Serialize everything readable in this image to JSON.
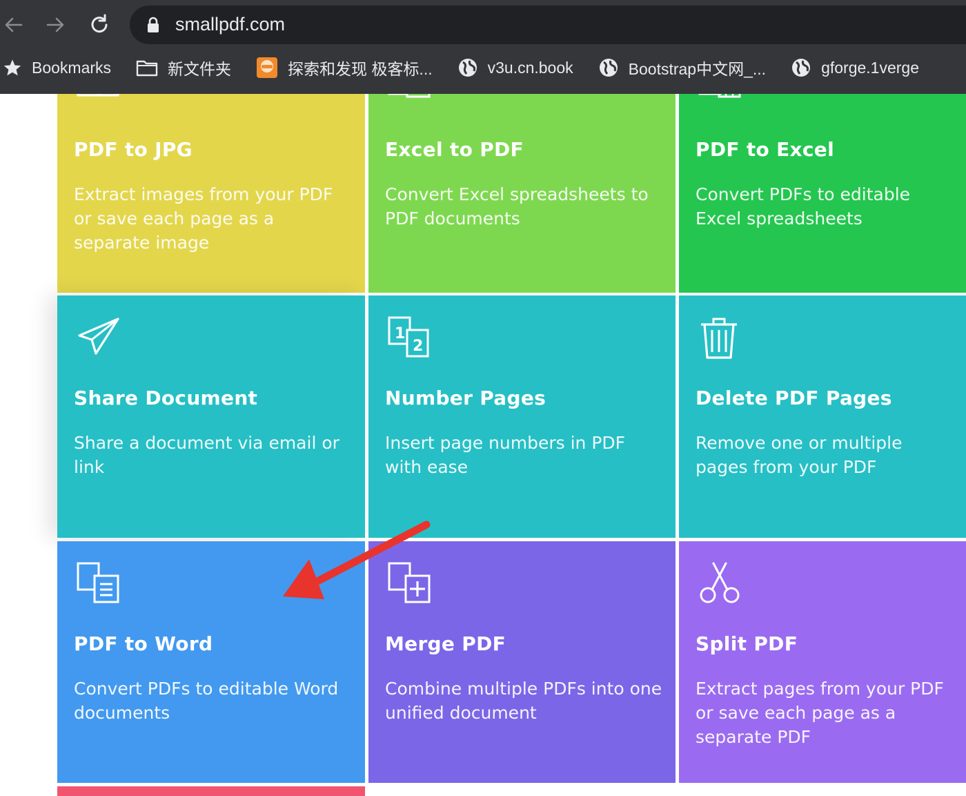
{
  "browser": {
    "url": "smallpdf.com",
    "bookmarks": [
      {
        "label": "Bookmarks",
        "icon": "star-icon"
      },
      {
        "label": "新文件夹",
        "icon": "folder-icon"
      },
      {
        "label": "探索和发现 极客标...",
        "icon": "site-favicon-icon"
      },
      {
        "label": "v3u.cn.book",
        "icon": "globe-icon"
      },
      {
        "label": "Bootstrap中文网_...",
        "icon": "globe-icon"
      },
      {
        "label": "gforge.1verge",
        "icon": "globe-icon"
      }
    ]
  },
  "tools": [
    {
      "title": "PDF to JPG",
      "desc": "Extract images from your PDF or save each page as a separate image",
      "color": "#e3d64b",
      "icon": "pdf-to-jpg-icon"
    },
    {
      "title": "Excel to PDF",
      "desc": "Convert Excel spreadsheets to PDF documents",
      "color": "#7ed84f",
      "icon": "excel-to-pdf-icon"
    },
    {
      "title": "PDF to Excel",
      "desc": "Convert PDFs to editable Excel spreadsheets",
      "color": "#24c64f",
      "icon": "pdf-to-excel-icon"
    },
    {
      "title": "Share Document",
      "desc": "Share a document via email or link",
      "color": "#26bfc5",
      "icon": "paper-plane-icon"
    },
    {
      "title": "Number Pages",
      "desc": "Insert page numbers in PDF with ease",
      "color": "#26bfc5",
      "icon": "number-pages-icon"
    },
    {
      "title": "Delete PDF Pages",
      "desc": "Remove one or multiple pages from your PDF",
      "color": "#26bfc5",
      "icon": "trash-icon"
    },
    {
      "title": "PDF to Word",
      "desc": "Convert PDFs to editable Word documents",
      "color": "#4299ef",
      "icon": "pdf-to-word-icon"
    },
    {
      "title": "Merge PDF",
      "desc": "Combine multiple PDFs into one unified document",
      "color": "#7b66e8",
      "icon": "merge-icon"
    },
    {
      "title": "Split PDF",
      "desc": "Extract pages from your PDF or save each page as a separate PDF",
      "color": "#9a6bf1",
      "icon": "scissors-icon"
    }
  ],
  "annotation": {
    "color": "#e8342c",
    "icon": "red-arrow-icon"
  }
}
